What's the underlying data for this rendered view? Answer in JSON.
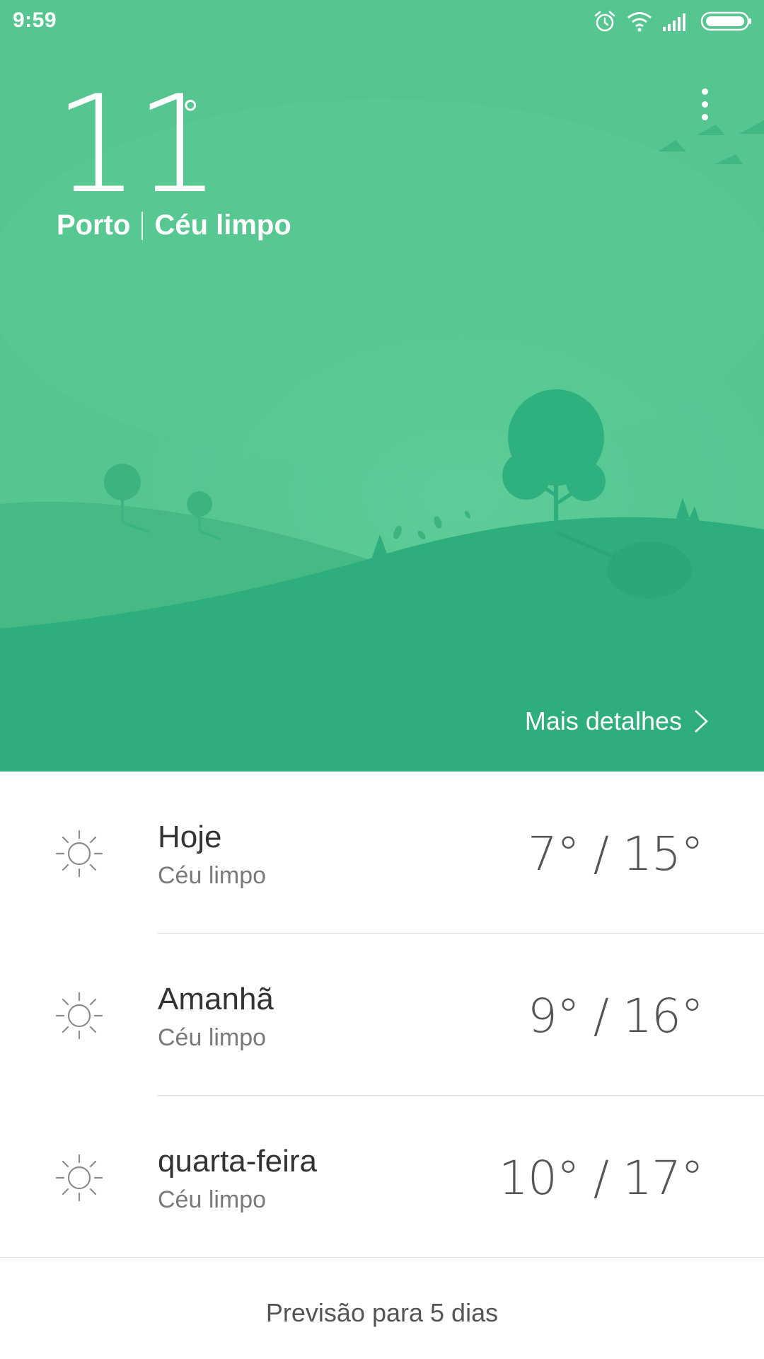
{
  "status_bar": {
    "time": "9:59",
    "icons": [
      "alarm-icon",
      "wifi-icon",
      "signal-icon",
      "battery-icon"
    ]
  },
  "current": {
    "temperature": "11",
    "degree_symbol": "°",
    "city": "Porto",
    "condition": "Céu limpo"
  },
  "menu": {
    "icon": "more-vert-icon"
  },
  "details_link": {
    "label": "Mais detalhes",
    "icon": "chevron-right-icon"
  },
  "forecast": [
    {
      "day": "Hoje",
      "condition": "Céu limpo",
      "temps": "7° / 15°",
      "icon": "sun-icon"
    },
    {
      "day": "Amanhã",
      "condition": "Céu limpo",
      "temps": "9° / 16°",
      "icon": "sun-icon"
    },
    {
      "day": "quarta-feira",
      "condition": "Céu limpo",
      "temps": "10° / 17°",
      "icon": "sun-icon"
    }
  ],
  "five_day_link": {
    "label": "Previsão para 5 dias"
  },
  "colors": {
    "sky": "#55c690",
    "hill_back": "#47b985",
    "hill_front": "#2fae7d",
    "tree": "#2fae7d"
  }
}
